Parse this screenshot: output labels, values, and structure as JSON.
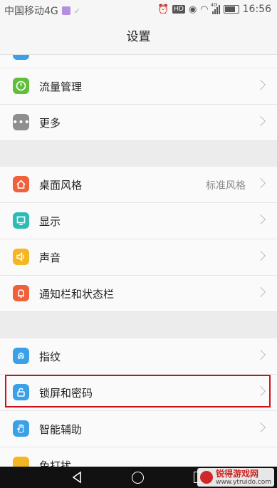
{
  "status_bar": {
    "carrier": "中国移动4G",
    "time": "16:56",
    "network_small": "4G",
    "hd": "HD"
  },
  "header": {
    "title": "设置"
  },
  "groups": [
    {
      "items": [
        {
          "label": "流量管理",
          "icon": "data-usage-icon",
          "color": "#5fbf3b"
        },
        {
          "label": "更多",
          "icon": "more-icon",
          "color": "#8e8e8e"
        }
      ]
    },
    {
      "items": [
        {
          "label": "桌面风格",
          "value": "标准风格",
          "icon": "home-icon",
          "color": "#f0603a"
        },
        {
          "label": "显示",
          "icon": "display-icon",
          "color": "#2bbcb5"
        },
        {
          "label": "声音",
          "icon": "sound-icon",
          "color": "#f5b623"
        },
        {
          "label": "通知栏和状态栏",
          "icon": "notification-icon",
          "color": "#f0603a"
        }
      ]
    },
    {
      "items": [
        {
          "label": "指纹",
          "icon": "fingerprint-icon",
          "color": "#3aa0e8"
        },
        {
          "label": "锁屏和密码",
          "icon": "lock-icon",
          "color": "#3aa0e8"
        },
        {
          "label": "智能辅助",
          "icon": "hand-icon",
          "color": "#3aa0e8"
        },
        {
          "label": "免打扰",
          "icon": "moon-icon",
          "color": "#f5b623"
        }
      ]
    }
  ],
  "watermark": {
    "text": "锐得游戏网",
    "url": "www.ytruido.com"
  }
}
